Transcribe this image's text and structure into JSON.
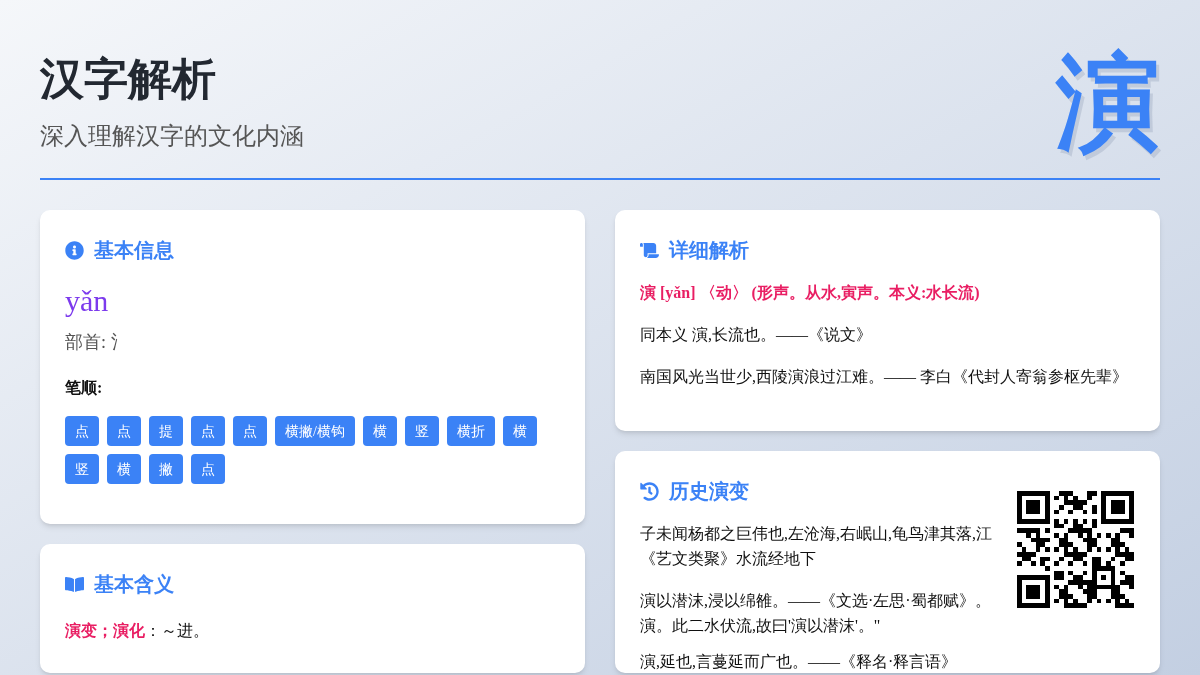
{
  "header": {
    "title": "汉字解析",
    "subtitle": "深入理解汉字的文化内涵",
    "character": "演"
  },
  "basic_info": {
    "title": "基本信息",
    "pinyin": "yǎn",
    "radical": "部首: 氵",
    "strokes_label": "笔顺:",
    "strokes": [
      "点",
      "点",
      "提",
      "点",
      "点",
      "横撇/横钩",
      "横",
      "竖",
      "横折",
      "横",
      "竖",
      "横",
      "撇",
      "点"
    ]
  },
  "basic_meaning": {
    "title": "基本含义",
    "entries": [
      {
        "term": "演变；演化",
        "definition": "：～进。"
      }
    ]
  },
  "detail": {
    "title": "详细解析",
    "headline": "演 [yǎn] 〈动〉 (形声。从水,寅声。本义:水长流)",
    "lines": [
      "同本义 演,长流也。——《说文》",
      "南国风光当世少,西陵演浪过江难。—— 李白《代封人寄翁参枢先辈》"
    ]
  },
  "history": {
    "title": "历史演变",
    "paragraphs": [
      {
        "lines": [
          "子未闻杨都之巨伟也,左沧海,右岷山,龟鸟津其落,江",
          "《艺文类聚》水流经地下"
        ]
      },
      {
        "lines": [
          "演以潜沫,浸以绵雒。——《文选·左思·蜀都赋》。",
          "演。此二水伏流,故曰'演以潜沫'。\""
        ]
      },
      {
        "lines": [
          "演,延也,言蔓延而广也。——《释名·释言语》"
        ]
      }
    ]
  }
}
